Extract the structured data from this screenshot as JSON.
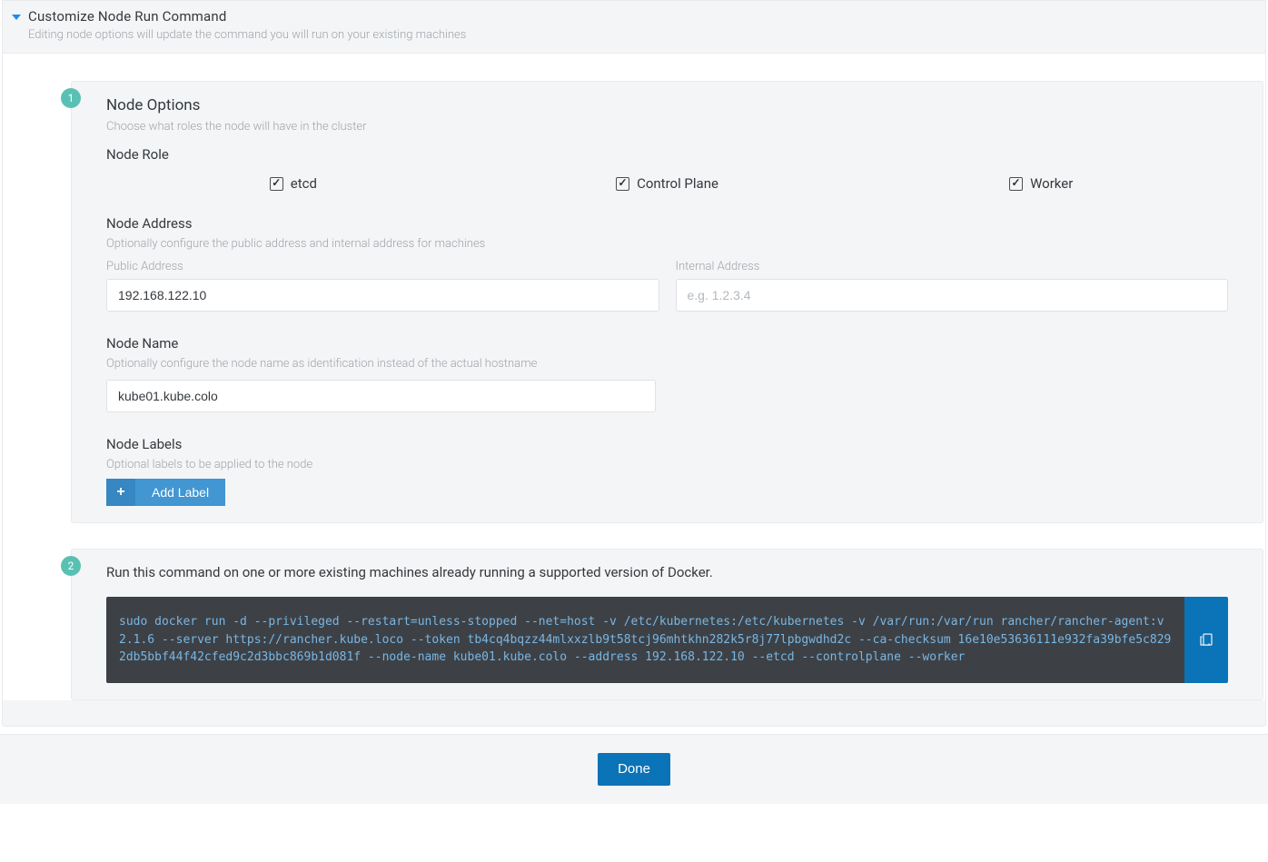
{
  "header": {
    "title": "Customize Node Run Command",
    "subtitle": "Editing node options will update the command you will run on your existing machines"
  },
  "step1": {
    "badge": "1",
    "title": "Node Options",
    "desc": "Choose what roles the node will have in the cluster",
    "node_role": {
      "heading": "Node Role",
      "roles": {
        "etcd": "etcd",
        "control_plane": "Control Plane",
        "worker": "Worker"
      }
    },
    "node_address": {
      "heading": "Node Address",
      "desc": "Optionally configure the public address and internal address for machines",
      "public_label": "Public Address",
      "public_value": "192.168.122.10",
      "internal_label": "Internal Address",
      "internal_placeholder": "e.g. 1.2.3.4"
    },
    "node_name": {
      "heading": "Node Name",
      "desc": "Optionally configure the node name as identification instead of the actual hostname",
      "value": "kube01.kube.colo"
    },
    "node_labels": {
      "heading": "Node Labels",
      "desc": "Optional labels to be applied to the node",
      "button": "Add Label"
    }
  },
  "step2": {
    "badge": "2",
    "title": "Run this command on one or more existing machines already running a supported version of Docker.",
    "command": "sudo docker run -d --privileged --restart=unless-stopped --net=host -v /etc/kubernetes:/etc/kubernetes -v /var/run:/var/run rancher/rancher-agent:v2.1.6 --server https://rancher.kube.loco --token tb4cq4bqzz44mlxxzlb9t58tcj96mhtkhn282k5r8j77lpbgwdhd2c --ca-checksum 16e10e53636111e932fa39bfe5c8292db5bbf44f42cfed9c2d3bbc869b1d081f --node-name kube01.kube.colo --address 192.168.122.10 --etcd --controlplane --worker"
  },
  "footer": {
    "done": "Done"
  }
}
